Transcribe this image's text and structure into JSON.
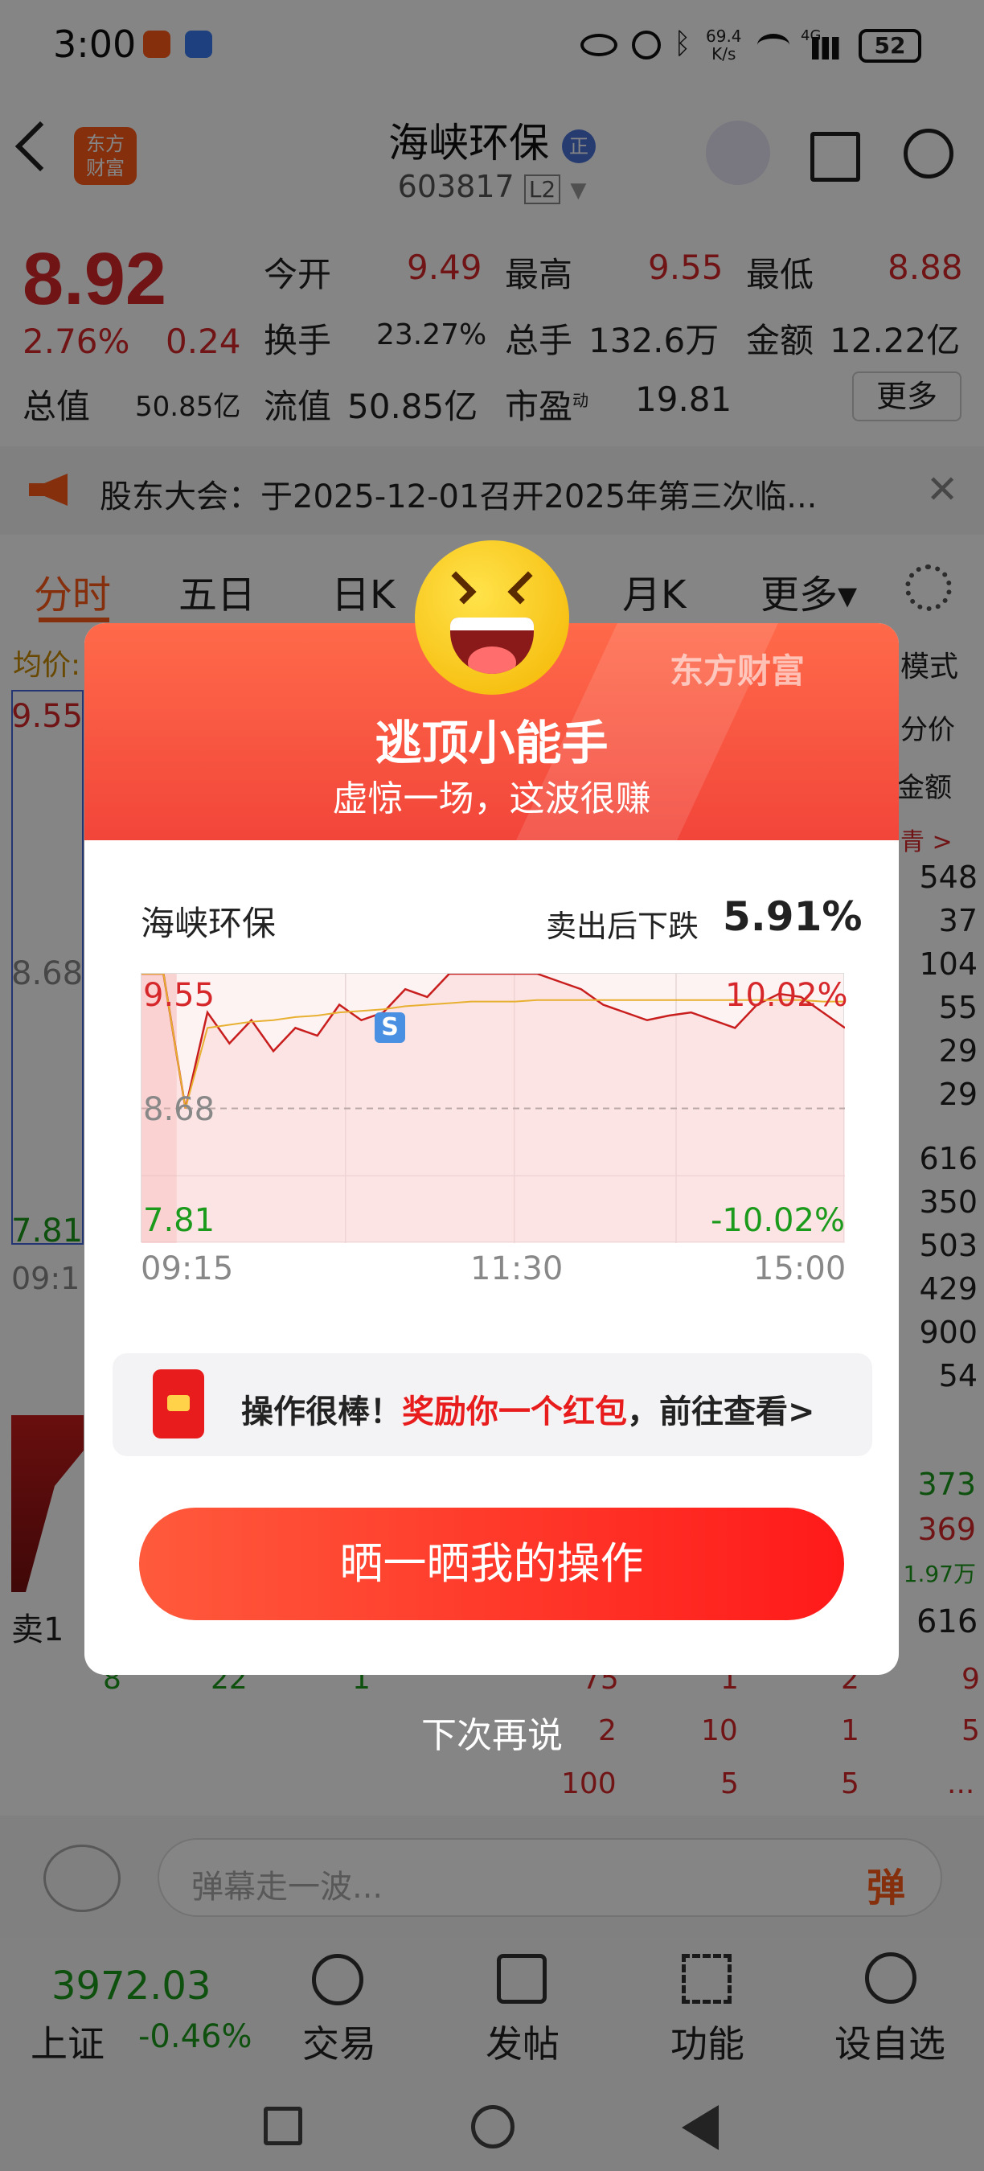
{
  "status_bar": {
    "time": "3:00",
    "net_speed_top": "69.4",
    "net_speed_bottom": "K/s",
    "battery": "52",
    "signal_label": "4G"
  },
  "header": {
    "logo_text_line1": "东方",
    "logo_text_line2": "财富",
    "stock_name": "海峡环保",
    "badge": "正",
    "stock_code": "603817",
    "level_badge": "L2"
  },
  "quote": {
    "price": "8.92",
    "change_pct": "2.76%",
    "change_amt": "0.24",
    "open_label": "今开",
    "open_value": "9.49",
    "high_label": "最高",
    "high_value": "9.55",
    "low_label": "最低",
    "low_value": "8.88",
    "turnover_label": "换手",
    "turnover_value": "23.27%",
    "volume_label": "总手",
    "volume_value": "132.6万",
    "amount_label": "金额",
    "amount_value": "12.22亿",
    "total_cap_label": "总值",
    "total_cap_value": "50.85亿",
    "float_cap_label": "流值",
    "float_cap_value": "50.85亿",
    "pe_label": "市盈",
    "pe_sup": "动",
    "pe_value": "19.81",
    "more_label": "更多"
  },
  "notice": {
    "text": "股东大会：于2025-12-01召开2025年第三次临..."
  },
  "tabs": [
    "分时",
    "五日",
    "日K",
    "月K",
    "更多▾"
  ],
  "background_chart": {
    "avg_label": "均价:",
    "mode_label": "模式",
    "price_top": "9.55",
    "price_mid": "8.68",
    "price_bottom": "7.81",
    "time_start": "09:1",
    "side_labels": [
      "分价",
      "金额"
    ],
    "side_arrow": "青 >",
    "side_values": [
      "548",
      "37",
      "104",
      "55",
      "29",
      "29"
    ],
    "side_values2": [
      "616",
      "350",
      "503",
      "429",
      "900",
      "54"
    ],
    "right_values": [
      "373",
      "369",
      "1.97万"
    ],
    "sell1_label": "卖1",
    "sell1_value": "616",
    "row1": [
      "8",
      "22",
      "1",
      "75",
      "1",
      "2",
      "9"
    ],
    "row2": [
      "2",
      "10",
      "1",
      "5"
    ],
    "row3": [
      "100",
      "5",
      "5",
      "..."
    ]
  },
  "popup": {
    "brand": "东方财富",
    "title": "逃顶小能手",
    "subtitle": "虚惊一场，这波很赚",
    "stock_name": "海峡环保",
    "drop_label": "卖出后下跌",
    "drop_value": "5.91%",
    "chart_top_label": "9.55",
    "chart_mid_label": "8.68",
    "chart_bottom_label": "7.81",
    "chart_top_pct": "10.02%",
    "chart_bottom_pct": "-10.02%",
    "time_labels": [
      "09:15",
      "11:30",
      "15:00"
    ],
    "sell_marker": "S",
    "reward_prefix": "操作很棒！",
    "reward_highlight": "奖励你一个红包",
    "reward_suffix": "，前往查看>",
    "share_button": "晒一晒我的操作",
    "dismiss": "下次再说"
  },
  "chart_data": {
    "type": "line",
    "title": "",
    "ylim": [
      7.81,
      9.55
    ],
    "reference_price": 8.68,
    "series": [
      {
        "values": [
          9.55,
          9.55,
          8.68,
          9.3,
          9.1,
          9.25,
          9.05,
          9.2,
          9.15,
          9.35,
          9.25,
          9.3,
          9.45,
          9.4,
          9.55,
          9.55,
          9.55,
          9.55,
          9.55,
          9.5,
          9.45,
          9.35,
          9.3,
          9.25,
          9.28,
          9.3,
          9.25,
          9.2,
          9.35,
          9.42,
          9.4,
          9.3,
          9.2
        ]
      },
      {
        "values": [
          9.55,
          9.55,
          8.68,
          9.2,
          9.22,
          9.24,
          9.25,
          9.27,
          9.28,
          9.3,
          9.31,
          9.32,
          9.34,
          9.35,
          9.36,
          9.37,
          9.37,
          9.37,
          9.38,
          9.38,
          9.38,
          9.38,
          9.38,
          9.38,
          9.38,
          9.38,
          9.38,
          9.38,
          9.38,
          9.38,
          9.38,
          9.37,
          9.37
        ]
      }
    ]
  },
  "chat": {
    "placeholder": "弹幕走一波...",
    "send_label": "弹"
  },
  "bottom_bar": {
    "index_value": "3972.03",
    "index_name": "上证",
    "index_change": "-0.46%",
    "items": [
      "交易",
      "发帖",
      "功能",
      "设自选"
    ]
  },
  "colors": {
    "red": "#d6282b",
    "green": "#1b9a1b",
    "popup_red": "#f2453a"
  }
}
